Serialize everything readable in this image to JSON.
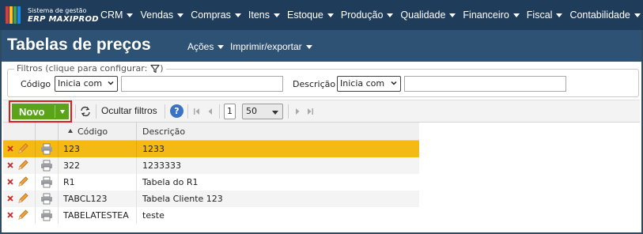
{
  "brand": {
    "line1": "Sistema de gestão",
    "line2": "ERP MAXIPROD"
  },
  "nav": {
    "items": [
      {
        "label": "CRM"
      },
      {
        "label": "Vendas"
      },
      {
        "label": "Compras"
      },
      {
        "label": "Itens"
      },
      {
        "label": "Estoque"
      },
      {
        "label": "Produção"
      },
      {
        "label": "Qualidade"
      },
      {
        "label": "Financeiro"
      },
      {
        "label": "Fiscal"
      },
      {
        "label": "Contabilidade"
      }
    ]
  },
  "header": {
    "title": "Tabelas de preços",
    "actions_label": "Ações",
    "print_label": "Imprimir/exportar"
  },
  "filters": {
    "legend": "Filtros (clique para configurar:",
    "legend_close": ")",
    "codigo_label": "Código",
    "codigo_mode": "Inicia com",
    "codigo_value": "",
    "descricao_label": "Descrição",
    "descricao_mode": "Inicia com",
    "descricao_value": ""
  },
  "toolbar": {
    "new_label": "Novo",
    "hide_filters_label": "Ocultar filtros",
    "help_label": "?",
    "page": "1",
    "page_size": "50"
  },
  "grid": {
    "columns": [
      "Código",
      "Descrição"
    ],
    "sorted_column": "Código",
    "rows": [
      {
        "codigo": "123",
        "descricao": "1233",
        "selected": true
      },
      {
        "codigo": "322",
        "descricao": "1233333",
        "selected": false
      },
      {
        "codigo": "R1",
        "descricao": "Tabela do R1",
        "selected": false
      },
      {
        "codigo": "TABCL123",
        "descricao": "Tabela Cliente 123",
        "selected": false
      },
      {
        "codigo": "TABELATESTEA",
        "descricao": "teste",
        "selected": false
      }
    ]
  },
  "colors": {
    "nav_bg": "#1f3d5a",
    "title_bg": "#2e5274",
    "new_button": "#5ca31c",
    "selected_row": "#f5b916",
    "highlight_border": "#e21b1b"
  },
  "icons": {
    "filter": "funnel-icon",
    "refresh": "refresh-icon",
    "help": "help-icon",
    "delete": "delete-x-icon",
    "edit": "pencil-icon",
    "print": "printer-icon"
  }
}
